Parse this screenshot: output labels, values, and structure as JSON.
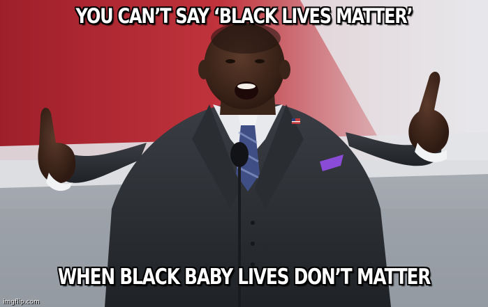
{
  "meme": {
    "top_text": "YOU CAN’T SAY ‘BLACK LIVES MATTER’",
    "bottom_text": "WHEN BLACK BABY LIVES DON’T MATTER",
    "watermark": "imgflip.com"
  },
  "colors": {
    "caption_fill": "#ffffff",
    "caption_outline": "#000000",
    "backdrop_red": "#b62a33",
    "backdrop_white": "#e8e8ec",
    "suit": "#2d3035",
    "pocket_square": "#8a4bd6"
  },
  "icons": {
    "flag_pin": "american-flag-pin-icon",
    "microphone": "microphone-icon"
  }
}
